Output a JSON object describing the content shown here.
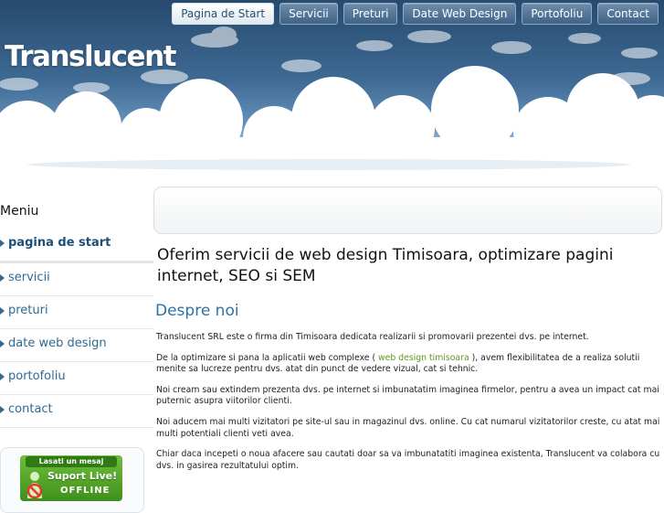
{
  "header": {
    "logo": "Translucent",
    "nav": [
      {
        "label": "Pagina de Start",
        "active": true
      },
      {
        "label": "Servicii",
        "active": false
      },
      {
        "label": "Preturi",
        "active": false
      },
      {
        "label": "Date Web Design",
        "active": false
      },
      {
        "label": "Portofoliu",
        "active": false
      },
      {
        "label": "Contact",
        "active": false
      }
    ]
  },
  "sidebar": {
    "title": "Meniu",
    "items": [
      {
        "label": "pagina de start",
        "active": true
      },
      {
        "label": "servicii",
        "active": false
      },
      {
        "label": "preturi",
        "active": false
      },
      {
        "label": "date web design",
        "active": false
      },
      {
        "label": "portofoliu",
        "active": false
      },
      {
        "label": "contact",
        "active": false
      }
    ],
    "support": {
      "top": "Lasati un mesaj",
      "line1": "Suport Live!",
      "line2": "OFFLINE"
    }
  },
  "main": {
    "heading": "Oferim servicii de web design Timisoara, optimizare pagini internet, SEO si SEM",
    "section_title": "Despre noi",
    "p1": "Translucent SRL este o firma din Timisoara dedicata realizarii si promovarii prezentei dvs. pe internet.",
    "p2_before": "De la optimizare si pana la aplicatii web complexe ( ",
    "p2_link": "web design timisoara",
    "p2_after": " ), avem flexibilitatea de a realiza solutii menite sa lucreze pentru dvs. atat din punct de vedere  vizual, cat si tehnic.",
    "p3": "Noi cream sau extindem prezenta dvs. pe internet si imbunatatim imaginea firmelor, pentru a avea un impact cat mai puternic asupra viitorilor clienti.",
    "p4": "Noi aducem mai multi vizitatori pe site-ul sau in magazinul dvs. online. Cu cat numarul vizitatorilor creste, cu atat mai multi potentiali clienti veti avea.",
    "p5": "Chiar daca incepeti o noua afacere sau cautati doar sa va imbunatatiti imaginea existenta, Translucent va colabora cu dvs. in gasirea rezultatului optim."
  },
  "colors": {
    "sky_dark": "#274a6e",
    "link_blue": "#2f6a95",
    "link_green": "#5b9a1f",
    "heading_blue": "#2a72a8"
  }
}
